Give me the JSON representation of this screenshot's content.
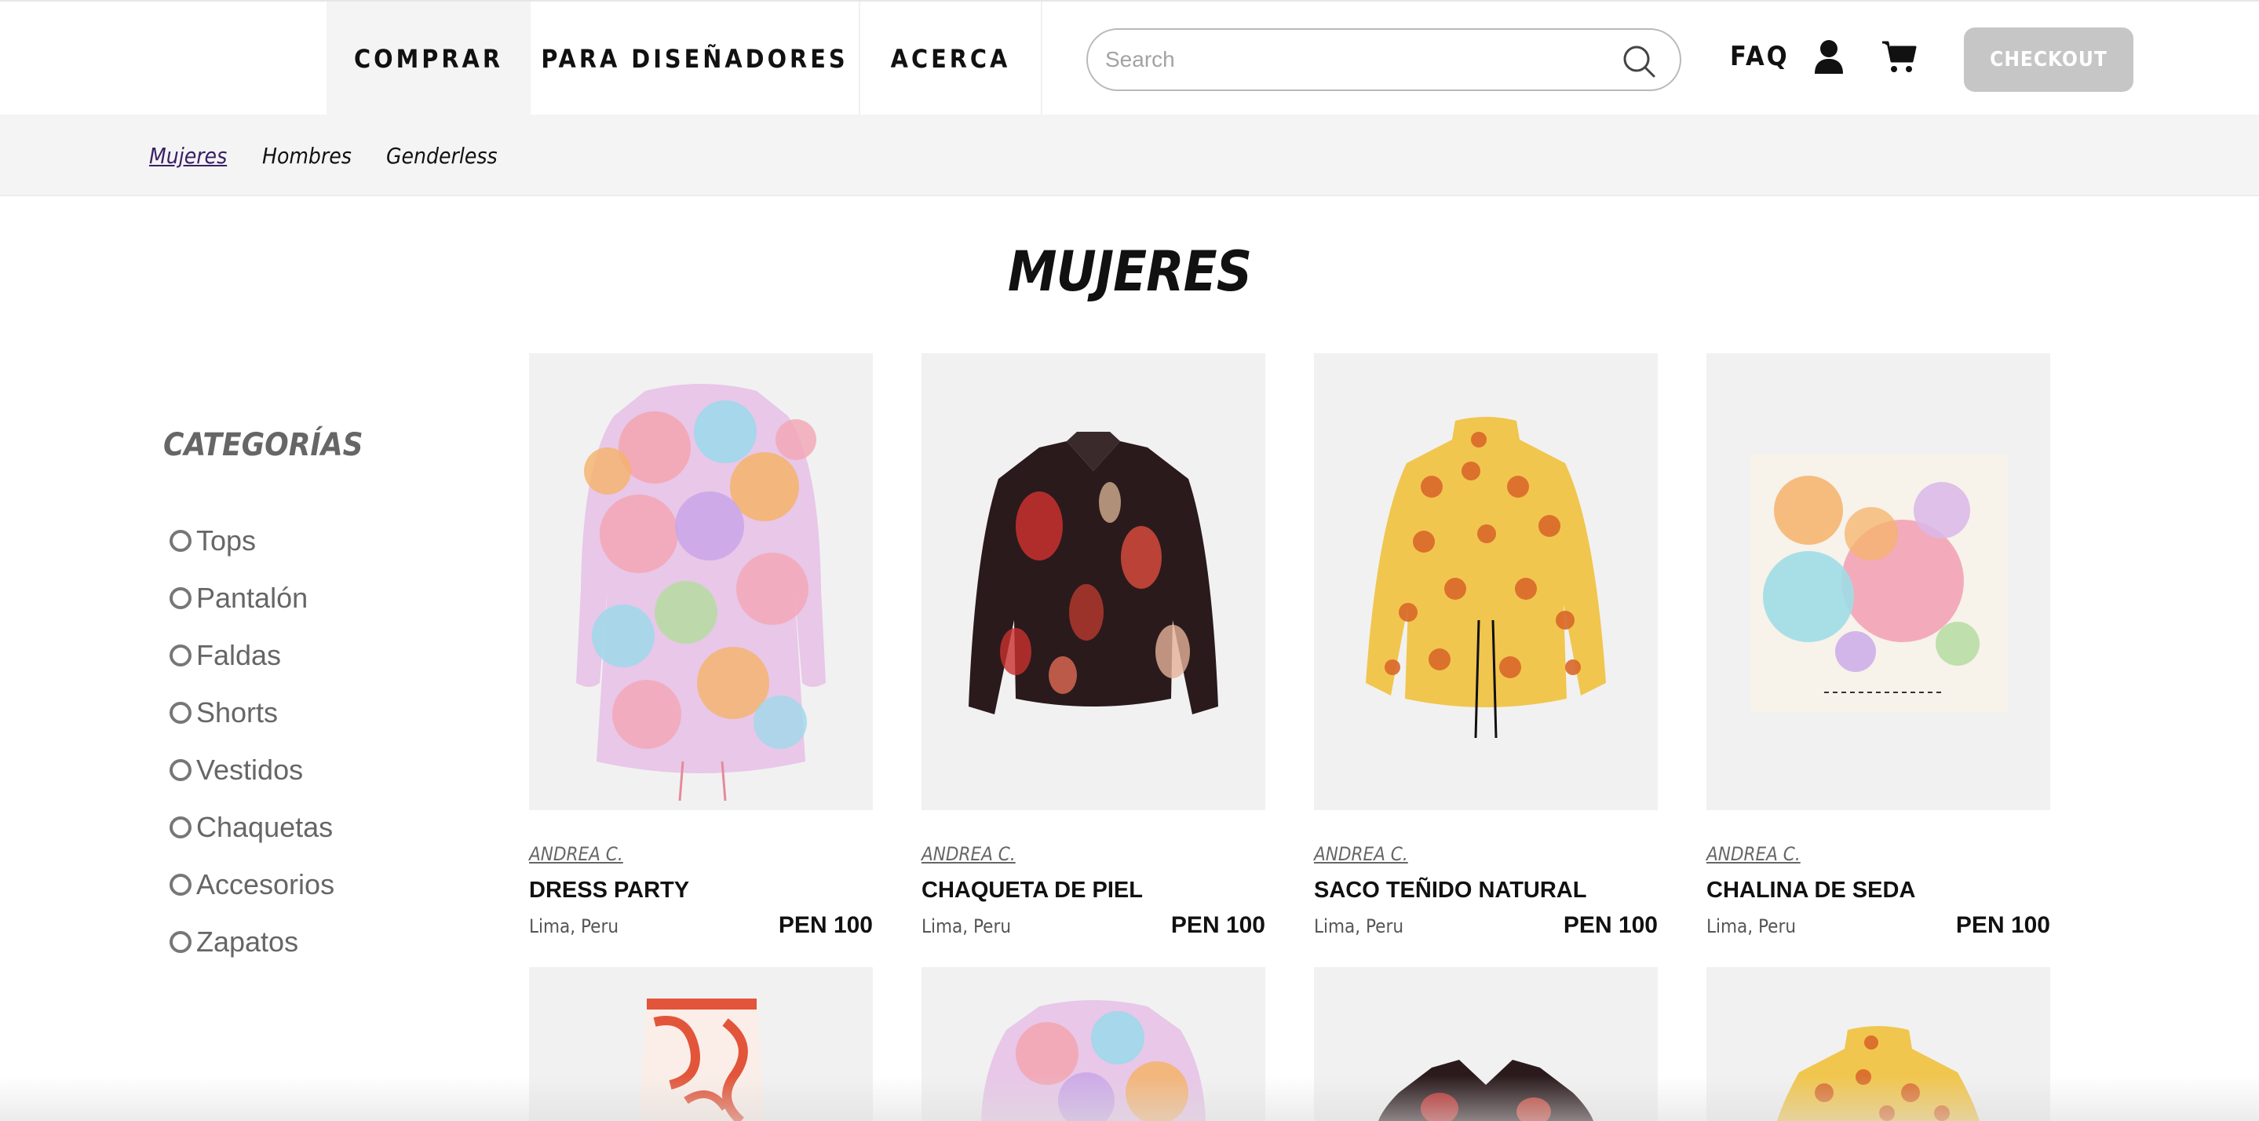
{
  "nav": {
    "items": [
      {
        "label": "COMPRAR",
        "active": true
      },
      {
        "label": "PARA DISEÑADORES",
        "active": false
      },
      {
        "label": "ACERCA",
        "active": false
      }
    ],
    "search": {
      "placeholder": "Search"
    },
    "faq": "FAQ",
    "checkout": "CHECKOUT"
  },
  "subnav": {
    "items": [
      {
        "label": "Mujeres",
        "active": true
      },
      {
        "label": "Hombres",
        "active": false
      },
      {
        "label": "Genderless",
        "active": false
      }
    ]
  },
  "page_title": "MUJERES",
  "sidebar": {
    "title": "CATEGORÍAS",
    "categories": [
      "Tops",
      "Pantalón",
      "Faldas",
      "Shorts",
      "Vestidos",
      "Chaquetas",
      "Accesorios",
      "Zapatos"
    ]
  },
  "products": [
    {
      "designer": "ANDREA C.",
      "name": "DRESS PARTY",
      "location": "Lima,  Peru",
      "price": "PEN 100"
    },
    {
      "designer": "ANDREA C.",
      "name": "CHAQUETA DE PIEL",
      "location": "Lima,  Peru",
      "price": "PEN 100"
    },
    {
      "designer": "ANDREA C.",
      "name": "SACO TEÑIDO NATURAL",
      "location": "Lima,  Peru",
      "price": "PEN 100"
    },
    {
      "designer": "ANDREA C.",
      "name": "CHALINA DE SEDA",
      "location": "Lima,  Peru",
      "price": "PEN 100"
    }
  ],
  "colors": {
    "accent_link": "#3a1f66",
    "checkout_bg": "#c6c6c6",
    "subnav_bg": "#f4f4f4"
  }
}
